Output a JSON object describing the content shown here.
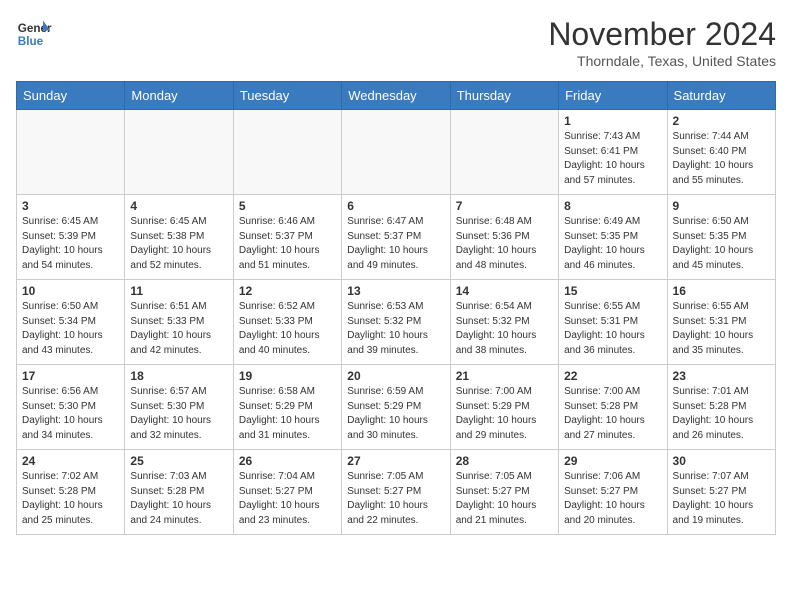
{
  "header": {
    "logo_line1": "General",
    "logo_line2": "Blue",
    "month": "November 2024",
    "location": "Thorndale, Texas, United States"
  },
  "days_of_week": [
    "Sunday",
    "Monday",
    "Tuesday",
    "Wednesday",
    "Thursday",
    "Friday",
    "Saturday"
  ],
  "weeks": [
    [
      {
        "day": "",
        "info": ""
      },
      {
        "day": "",
        "info": ""
      },
      {
        "day": "",
        "info": ""
      },
      {
        "day": "",
        "info": ""
      },
      {
        "day": "",
        "info": ""
      },
      {
        "day": "1",
        "info": "Sunrise: 7:43 AM\nSunset: 6:41 PM\nDaylight: 10 hours\nand 57 minutes."
      },
      {
        "day": "2",
        "info": "Sunrise: 7:44 AM\nSunset: 6:40 PM\nDaylight: 10 hours\nand 55 minutes."
      }
    ],
    [
      {
        "day": "3",
        "info": "Sunrise: 6:45 AM\nSunset: 5:39 PM\nDaylight: 10 hours\nand 54 minutes."
      },
      {
        "day": "4",
        "info": "Sunrise: 6:45 AM\nSunset: 5:38 PM\nDaylight: 10 hours\nand 52 minutes."
      },
      {
        "day": "5",
        "info": "Sunrise: 6:46 AM\nSunset: 5:37 PM\nDaylight: 10 hours\nand 51 minutes."
      },
      {
        "day": "6",
        "info": "Sunrise: 6:47 AM\nSunset: 5:37 PM\nDaylight: 10 hours\nand 49 minutes."
      },
      {
        "day": "7",
        "info": "Sunrise: 6:48 AM\nSunset: 5:36 PM\nDaylight: 10 hours\nand 48 minutes."
      },
      {
        "day": "8",
        "info": "Sunrise: 6:49 AM\nSunset: 5:35 PM\nDaylight: 10 hours\nand 46 minutes."
      },
      {
        "day": "9",
        "info": "Sunrise: 6:50 AM\nSunset: 5:35 PM\nDaylight: 10 hours\nand 45 minutes."
      }
    ],
    [
      {
        "day": "10",
        "info": "Sunrise: 6:50 AM\nSunset: 5:34 PM\nDaylight: 10 hours\nand 43 minutes."
      },
      {
        "day": "11",
        "info": "Sunrise: 6:51 AM\nSunset: 5:33 PM\nDaylight: 10 hours\nand 42 minutes."
      },
      {
        "day": "12",
        "info": "Sunrise: 6:52 AM\nSunset: 5:33 PM\nDaylight: 10 hours\nand 40 minutes."
      },
      {
        "day": "13",
        "info": "Sunrise: 6:53 AM\nSunset: 5:32 PM\nDaylight: 10 hours\nand 39 minutes."
      },
      {
        "day": "14",
        "info": "Sunrise: 6:54 AM\nSunset: 5:32 PM\nDaylight: 10 hours\nand 38 minutes."
      },
      {
        "day": "15",
        "info": "Sunrise: 6:55 AM\nSunset: 5:31 PM\nDaylight: 10 hours\nand 36 minutes."
      },
      {
        "day": "16",
        "info": "Sunrise: 6:55 AM\nSunset: 5:31 PM\nDaylight: 10 hours\nand 35 minutes."
      }
    ],
    [
      {
        "day": "17",
        "info": "Sunrise: 6:56 AM\nSunset: 5:30 PM\nDaylight: 10 hours\nand 34 minutes."
      },
      {
        "day": "18",
        "info": "Sunrise: 6:57 AM\nSunset: 5:30 PM\nDaylight: 10 hours\nand 32 minutes."
      },
      {
        "day": "19",
        "info": "Sunrise: 6:58 AM\nSunset: 5:29 PM\nDaylight: 10 hours\nand 31 minutes."
      },
      {
        "day": "20",
        "info": "Sunrise: 6:59 AM\nSunset: 5:29 PM\nDaylight: 10 hours\nand 30 minutes."
      },
      {
        "day": "21",
        "info": "Sunrise: 7:00 AM\nSunset: 5:29 PM\nDaylight: 10 hours\nand 29 minutes."
      },
      {
        "day": "22",
        "info": "Sunrise: 7:00 AM\nSunset: 5:28 PM\nDaylight: 10 hours\nand 27 minutes."
      },
      {
        "day": "23",
        "info": "Sunrise: 7:01 AM\nSunset: 5:28 PM\nDaylight: 10 hours\nand 26 minutes."
      }
    ],
    [
      {
        "day": "24",
        "info": "Sunrise: 7:02 AM\nSunset: 5:28 PM\nDaylight: 10 hours\nand 25 minutes."
      },
      {
        "day": "25",
        "info": "Sunrise: 7:03 AM\nSunset: 5:28 PM\nDaylight: 10 hours\nand 24 minutes."
      },
      {
        "day": "26",
        "info": "Sunrise: 7:04 AM\nSunset: 5:27 PM\nDaylight: 10 hours\nand 23 minutes."
      },
      {
        "day": "27",
        "info": "Sunrise: 7:05 AM\nSunset: 5:27 PM\nDaylight: 10 hours\nand 22 minutes."
      },
      {
        "day": "28",
        "info": "Sunrise: 7:05 AM\nSunset: 5:27 PM\nDaylight: 10 hours\nand 21 minutes."
      },
      {
        "day": "29",
        "info": "Sunrise: 7:06 AM\nSunset: 5:27 PM\nDaylight: 10 hours\nand 20 minutes."
      },
      {
        "day": "30",
        "info": "Sunrise: 7:07 AM\nSunset: 5:27 PM\nDaylight: 10 hours\nand 19 minutes."
      }
    ]
  ]
}
